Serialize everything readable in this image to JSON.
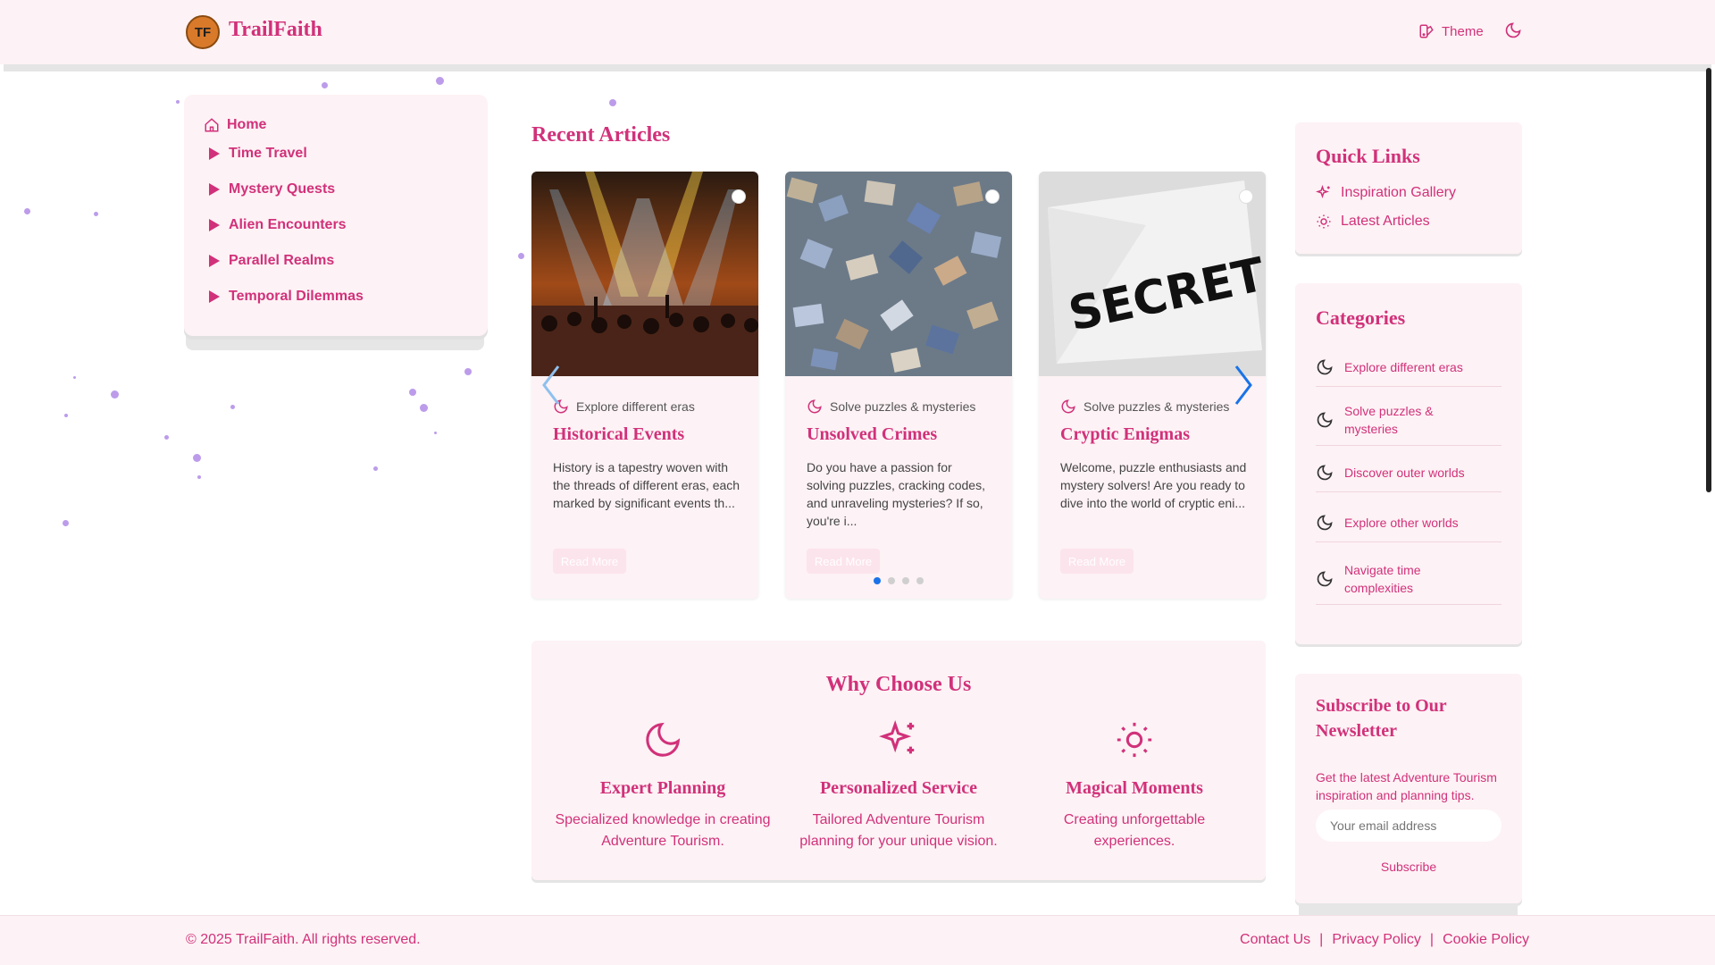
{
  "header": {
    "logo_initials": "TF",
    "brand": "TrailFaith",
    "theme_label": "Theme"
  },
  "sidebar": {
    "home_label": "Home",
    "items": [
      {
        "label": "Time Travel"
      },
      {
        "label": "Mystery Quests"
      },
      {
        "label": "Alien Encounters"
      },
      {
        "label": "Parallel Realms"
      },
      {
        "label": "Temporal Dilemmas"
      }
    ]
  },
  "recent": {
    "title": "Recent Articles",
    "cards": [
      {
        "category": "Explore different eras",
        "title": "Historical Events",
        "excerpt": "History is a tapestry woven with the threads of different eras, each marked by significant events th...",
        "more": "Read More",
        "image": "concert-crowd"
      },
      {
        "category": "Solve puzzles & mysteries",
        "title": "Unsolved Crimes",
        "excerpt": "Do you have a passion for solving puzzles, cracking codes, and unraveling mysteries? If so, you're i...",
        "more": "Read More",
        "image": "jigsaw-pieces"
      },
      {
        "category": "Solve puzzles & mysteries",
        "title": "Cryptic Enigmas",
        "excerpt": "Welcome, puzzle enthusiasts and mystery solvers! Are you ready to dive into the world of cryptic eni...",
        "more": "Read More",
        "image": "secret-paper",
        "image_text": "SECRET"
      }
    ],
    "pagination": {
      "pages": 4,
      "active": 1
    }
  },
  "why": {
    "title": "Why Choose Us",
    "features": [
      {
        "icon": "moon-icon",
        "title": "Expert Planning",
        "desc": "Specialized knowledge in creating Adventure Tourism."
      },
      {
        "icon": "sparkles-icon",
        "title": "Personalized Service",
        "desc": "Tailored Adventure Tourism planning for your unique vision."
      },
      {
        "icon": "sun-icon",
        "title": "Magical Moments",
        "desc": "Creating unforgettable experiences."
      }
    ]
  },
  "quick_links": {
    "title": "Quick Links",
    "items": [
      {
        "icon": "sparkles-icon",
        "label": "Inspiration Gallery"
      },
      {
        "icon": "sun-icon",
        "label": "Latest Articles"
      }
    ]
  },
  "categories": {
    "title": "Categories",
    "items": [
      {
        "label": "Explore different eras"
      },
      {
        "label": "Solve puzzles & mysteries"
      },
      {
        "label": "Discover outer worlds"
      },
      {
        "label": "Explore other worlds"
      },
      {
        "label": "Navigate time complexities"
      }
    ]
  },
  "newsletter": {
    "title": "Subscribe to Our Newsletter",
    "desc": "Get the latest Adventure Tourism inspiration and planning tips.",
    "placeholder": "Your email address",
    "button": "Subscribe"
  },
  "footer": {
    "copyright": "© 2025 TrailFaith. All rights reserved.",
    "links": [
      "Contact Us",
      "Privacy Policy",
      "Cookie Policy"
    ],
    "separator": "|"
  },
  "colors": {
    "accent": "#d1317a",
    "panel": "#fdf2f5",
    "particle": "#b08be6"
  }
}
